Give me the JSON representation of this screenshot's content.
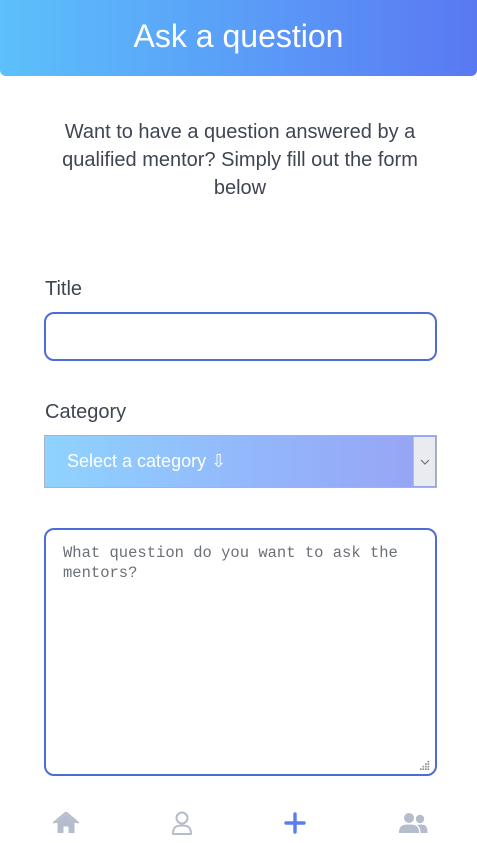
{
  "header": {
    "title": "Ask a question"
  },
  "intro": {
    "text": "Want to have a question answered by a qualified mentor? Simply fill out the form below"
  },
  "form": {
    "title_label": "Title",
    "title_value": "",
    "category_label": "Category",
    "category_selected": "Select a category ⇩",
    "question_placeholder": "What question do you want to ask the mentors?"
  },
  "nav": {
    "items": [
      "home-icon",
      "profile-icon",
      "add-icon",
      "mentors-icon"
    ],
    "active": "add-icon",
    "active_color": "#5a7ef2",
    "inactive_color": "#b5bccb"
  },
  "colors": {
    "header_gradient_start": "#5cc0fb",
    "header_gradient_end": "#5a78f2",
    "border_accent": "#4f6bd6"
  }
}
